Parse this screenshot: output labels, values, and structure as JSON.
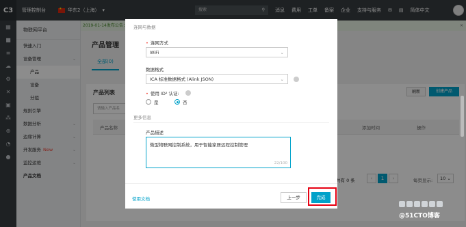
{
  "topbar": {
    "logo": "C3",
    "console": "管理控制台",
    "region": "华东2（上海）",
    "region_caret": "▾",
    "search_placeholder": "搜索",
    "search_icon": "search-icon",
    "menu": [
      "消息",
      "费用",
      "工单",
      "备案",
      "企业",
      "支持与服务",
      "✉",
      "▤",
      "简体中文"
    ]
  },
  "sidebar": {
    "title": "物联网平台",
    "items": [
      {
        "label": "快速入门",
        "sub": false,
        "arrow": false
      },
      {
        "label": "设备管理",
        "sub": false,
        "arrow": true
      },
      {
        "label": "产品",
        "sub": true,
        "arrow": false,
        "active": true
      },
      {
        "label": "设备",
        "sub": true,
        "arrow": false
      },
      {
        "label": "分组",
        "sub": true,
        "arrow": false
      },
      {
        "label": "规则引擎",
        "sub": false,
        "arrow": false
      },
      {
        "label": "数据分析",
        "sub": false,
        "arrow": true
      },
      {
        "label": "边缘计算",
        "sub": false,
        "arrow": true
      },
      {
        "label": "开发服务",
        "sub": false,
        "arrow": true,
        "badge": "New"
      },
      {
        "label": "监控运维",
        "sub": false,
        "arrow": true
      },
      {
        "label": "产品文档",
        "sub": false,
        "arrow": false,
        "bold": true
      }
    ]
  },
  "notice": "2019-01-14发布公告：",
  "page_title": "产品管理",
  "tab_all": "全部(0)",
  "card": {
    "title": "产品列表",
    "refresh": "刷新",
    "create": "创建产品",
    "search_placeholder": "请输入产品名",
    "col_name": "产品名称",
    "col_time": "添加时间",
    "col_op": "操作",
    "total": "共有 0 条",
    "prev": "‹",
    "page": "1",
    "next": "›",
    "per_page_label": "每页显示:",
    "per_page": "10"
  },
  "modal": {
    "section_conn": "连网与数据",
    "conn_label": "连网方式",
    "conn_value": "WiFi",
    "format_label": "数据格式",
    "format_value": "ICA 标准数据格式 (Alink JSON)",
    "id2_label": "使用 ID² 认证:",
    "id2_yes": "是",
    "id2_no": "否",
    "id2_selected": "否",
    "section_more": "更多信息",
    "desc_label": "产品描述",
    "desc_value": "微型物联网控制系统，用于智能家居远程控制管理",
    "desc_count": "22/100",
    "doc_link": "使用文档",
    "prev_button": "上一步",
    "done_button": "完成"
  },
  "watermark": "@51CTO博客"
}
